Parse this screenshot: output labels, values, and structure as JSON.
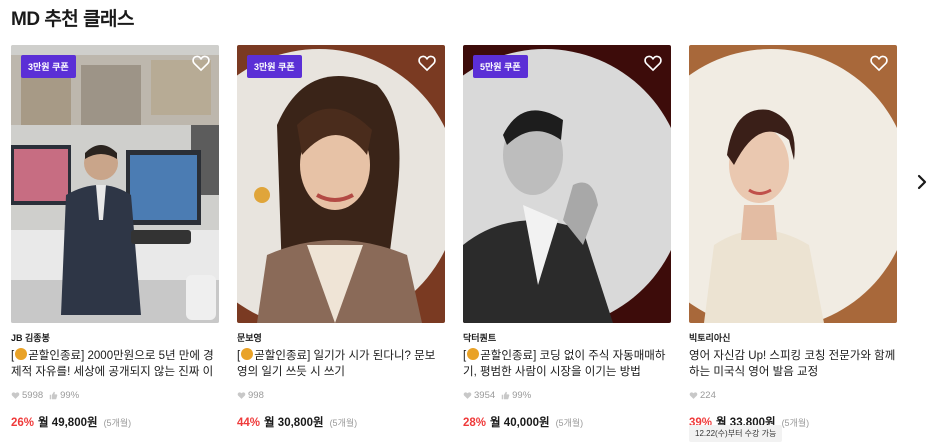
{
  "section": {
    "title": "MD 추천 클래스"
  },
  "cards": [
    {
      "coupon": "3만원 쿠폰",
      "creator": "JB 김종봉",
      "title_prefix": "[",
      "title_tag": "곧할인종료]",
      "title_text": " 2000만원으로 5년 만에 경제적 자유를! 세상에 공개되지 않는 진짜 이야기!",
      "likes": "5998",
      "rating": "99%",
      "discount": "26%",
      "price": "월 49,800원",
      "period": "(5개월)",
      "colors": {
        "panel": "#ececec"
      }
    },
    {
      "coupon": "3만원 쿠폰",
      "creator": "문보영",
      "title_prefix": "[",
      "title_tag": "곧할인종료]",
      "title_text": " 일기가 시가 된다니? 문보영의 일기 쓰듯 시 쓰기",
      "likes": "998",
      "rating": "",
      "discount": "44%",
      "price": "월 30,800원",
      "period": "(5개월)",
      "colors": {
        "panel": "#7a3a22",
        "circle": "#e8e4de"
      }
    },
    {
      "coupon": "5만원 쿠폰",
      "creator": "닥터퀀트",
      "title_prefix": "[",
      "title_tag": "곧할인종료]",
      "title_text": " 코딩 없이 주식 자동매매하기, 평범한 사람이 시장을 이기는 방법",
      "likes": "3954",
      "rating": "99%",
      "discount": "28%",
      "price": "월 40,000원",
      "period": "(5개월)",
      "colors": {
        "panel": "#3d0c0a",
        "circle": "#d9d9d9"
      }
    },
    {
      "coupon": "",
      "creator": "빅토리아신",
      "title_prefix": "",
      "title_tag": "",
      "title_text": "영어 자신감 Up! 스피킹 코칭 전문가와 함께 하는 미국식 영어 발음 교정",
      "likes": "224",
      "rating": "",
      "discount": "39%",
      "price": "월 33,800원",
      "period": "(5개월)",
      "colors": {
        "panel": "#a8683a",
        "circle": "#f1ece3"
      }
    }
  ],
  "notice": "12.22(수)부터 수강 가능",
  "icons": {
    "heart": "heart-icon",
    "like": "heart-small-icon",
    "rating": "thumbs-up-icon",
    "next": "chevron-right-icon"
  }
}
